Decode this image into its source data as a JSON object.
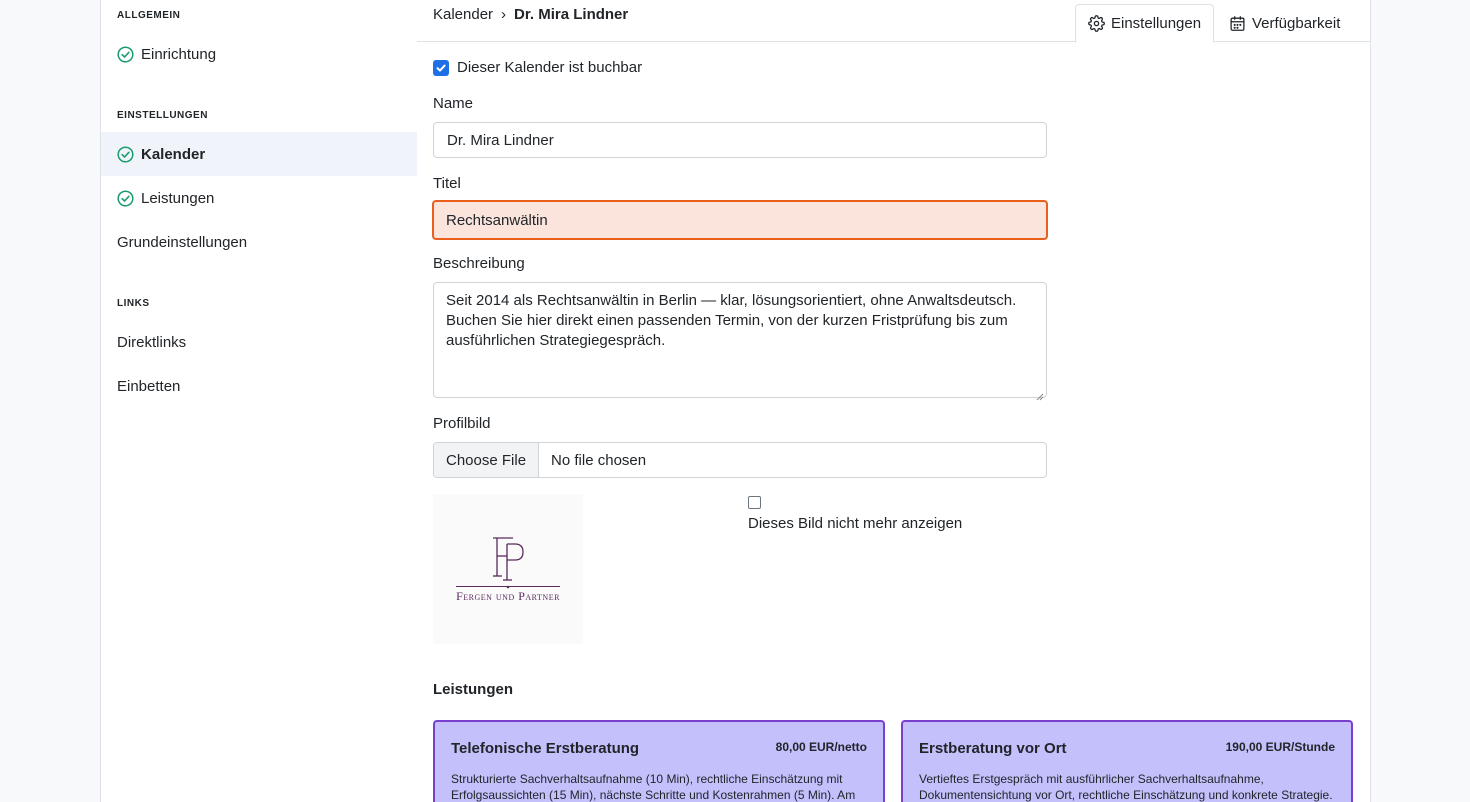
{
  "sidebar": {
    "sections": [
      {
        "heading": "ALLGEMEIN",
        "items": [
          {
            "label": "Einrichtung",
            "check": true
          }
        ]
      },
      {
        "heading": "EINSTELLUNGEN",
        "items": [
          {
            "label": "Kalender",
            "check": true,
            "active": true
          },
          {
            "label": "Leistungen",
            "check": true
          },
          {
            "label": "Grundeinstellungen",
            "check": false
          }
        ]
      },
      {
        "heading": "LINKS",
        "items": [
          {
            "label": "Direktlinks",
            "check": false
          },
          {
            "label": "Einbetten",
            "check": false
          }
        ]
      }
    ]
  },
  "breadcrumb": {
    "parent": "Kalender",
    "separator": "›",
    "current": "Dr. Mira Lindner"
  },
  "tabs": [
    {
      "label": "Einstellungen",
      "icon": "gear-icon",
      "active": true
    },
    {
      "label": "Verfügbarkeit",
      "icon": "calendar-icon",
      "active": false
    }
  ],
  "form": {
    "bookable_label": "Dieser Kalender ist buchbar",
    "bookable_checked": true,
    "name_label": "Name",
    "name_value": "Dr. Mira Lindner",
    "title_label": "Titel",
    "title_value": "Rechtsanwältin",
    "description_label": "Beschreibung",
    "description_value": "Seit 2014 als Rechtsanwältin in Berlin — klar, lösungsorientiert, ohne Anwaltsdeutsch. Buchen Sie hier direkt einen passenden Termin, von der kurzen Fristprüfung bis zum ausführlichen Strategiegespräch.",
    "profile_label": "Profilbild",
    "file_button": "Choose File",
    "file_status": "No file chosen",
    "logo_text": "Fergen und Partner",
    "hide_image_label": "Dieses Bild nicht mehr anzeigen",
    "hide_image_checked": false
  },
  "services": {
    "heading": "Leistungen",
    "cards": [
      {
        "title": "Telefonische Erstberatung",
        "price": "80,00 EUR/netto",
        "description": "Strukturierte Sachverhaltsaufnahme (10 Min), rechtliche Einschätzung mit Erfolgsaussichten (15 Min), nächste Schritte und Kostenrahmen (5 Min). Am"
      },
      {
        "title": "Erstberatung vor Ort",
        "price": "190,00 EUR/Stunde",
        "description": "Vertieftes Erstgespräch mit ausführlicher Sachverhaltsaufnahme, Dokumentensichtung vor Ort, rechtliche Einschätzung und konkrete Strategie."
      }
    ]
  },
  "colors": {
    "accent": "#1f6fe6",
    "check": "#1a9c6c",
    "error_border": "#e8601c",
    "error_bg": "#fbe4dc",
    "card_bg": "#c3c0fb",
    "card_border": "#7a3fcf"
  }
}
